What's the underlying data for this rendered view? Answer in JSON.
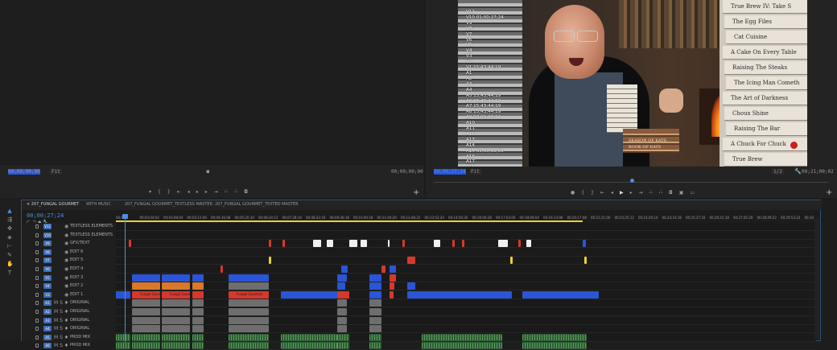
{
  "source_monitor": {
    "timecode_left": "00;00;00;00",
    "fit_label": "Fit",
    "timecode_right": "00;00;00;00",
    "add_label": "+"
  },
  "program_monitor": {
    "timecode_left": "00;00;27;24",
    "fit_label": "Fit",
    "zoom_label": "1/2",
    "timecode_right": "00;21;00;02",
    "add_label": "+",
    "overlay_lines": [
      "V11",
      "V10 01;00;27;24",
      "V9",
      "V8",
      "V7",
      "V6",
      "V5",
      "V4",
      "V3",
      "V2",
      "V1 15;43;44;19",
      "A1",
      "A2",
      "A3",
      "A4",
      "A5 15;43;44;19",
      "A6 15;43;44;19",
      "A7 15;43;44;19",
      "A8 15;43;44;19",
      "A9 00;00;28;12",
      "A10",
      "A11",
      "A12",
      "A13",
      "A14",
      "A15 00;00;39;05",
      "A16",
      "A17",
      "A18",
      "A19 00;00;27;24"
    ],
    "book_titles": [
      "True Brew IV: Take S",
      "The Egg Files",
      "Cat Cuisine",
      "A Cake On Every Table",
      "Raising The Steaks",
      "The Icing Man Cometh",
      "The Art of Darkness",
      "Choux Shine",
      "Raising The Bar",
      "A Chuck For Chuck",
      "True Brew"
    ],
    "shelf_books": [
      "SEASON OF EATS",
      "BOOK OF EATS"
    ]
  },
  "timeline": {
    "tabs": [
      {
        "label": "207_FUNGAL GOURMET",
        "active": true
      },
      {
        "label": "WITH MUSIC",
        "active": false
      },
      {
        "label": "207_FUNGAL GOURMET_TEXTLESS MASTER",
        "active": false
      },
      {
        "label": "207_FUNGAL GOURMET_TEXTED MASTER",
        "active": false
      }
    ],
    "timecode": "00;00;27;24",
    "ruler_ticks": [
      "00;00",
      "00;03;04;02",
      "00;03;08;04",
      "00;03;12;06",
      "00;04;16;08",
      "00;05;20;10",
      "00;06;24;12",
      "00;07;28;14",
      "00;08;32;16",
      "00;09;36;18",
      "00;10;40;18",
      "00;11;44;20",
      "00;12;48;22",
      "00;13;52;24",
      "00;14;56;26",
      "00;16;00;28",
      "00;17;03;00",
      "00;18;09;04",
      "00;19;13;06",
      "00;20;17;08",
      "00;21;21;00",
      "00;22;25;12",
      "00;23;29;14",
      "00;24;33;16",
      "00;25;37;16",
      "00;26;41;18",
      "00;27;45;20",
      "00;28;49;22",
      "00;29;53;24",
      "00;30"
    ],
    "video_tracks": [
      {
        "id": "V11",
        "name": "TEXTLESS ELEMENTS"
      },
      {
        "id": "V10",
        "name": "TEXTLESS ELEMENTS"
      },
      {
        "id": "V9",
        "name": "GFX/TEXT"
      },
      {
        "id": "V8",
        "name": "EDIT 6"
      },
      {
        "id": "V7",
        "name": "EDIT 5"
      },
      {
        "id": "V6",
        "name": "EDIT 4"
      },
      {
        "id": "V5",
        "name": "EDIT 3"
      },
      {
        "id": "V4",
        "name": "EDIT 2"
      },
      {
        "id": "V3",
        "name": "EDIT 1"
      }
    ],
    "audio_tracks": [
      {
        "id": "A1",
        "name": "ORIGINAL"
      },
      {
        "id": "A2",
        "name": "ORIGINAL"
      },
      {
        "id": "A3",
        "name": "ORIGINAL"
      },
      {
        "id": "A4",
        "name": "ORIGINAL"
      },
      {
        "id": "A5",
        "name": "PROD MIX"
      },
      {
        "id": "A6",
        "name": "PROD MIX"
      }
    ],
    "clip_label": "Fungal Gourmet"
  }
}
